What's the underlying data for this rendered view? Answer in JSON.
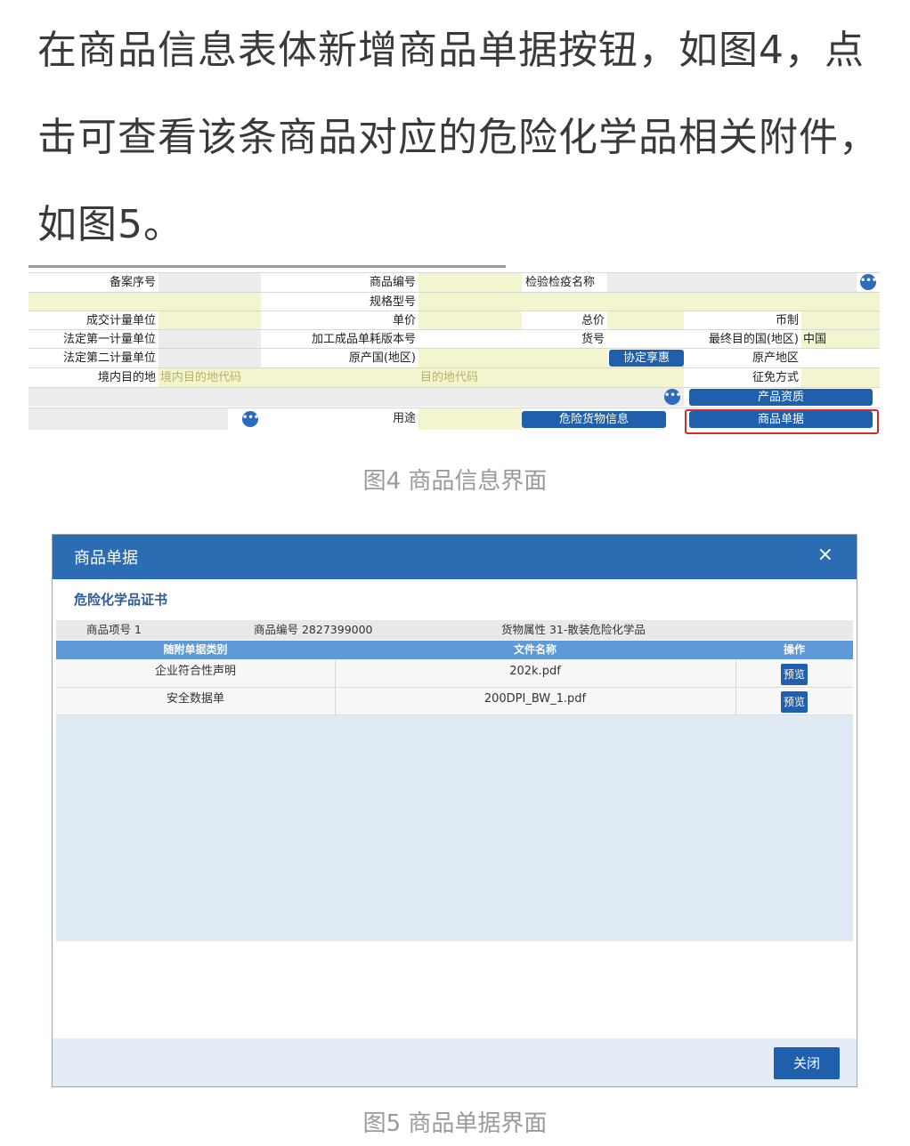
{
  "intro_text": "在商品信息表体新增商品单据按钮，如图4，点击可查看该条商品对应的危险化学品相关附件，如图5。",
  "fig4": {
    "caption": "图4 商品信息界面",
    "labels": {
      "record_no": "备案序号",
      "product_code": "商品编号",
      "ciq_name": "检验检疫名称",
      "spec_model": "规格型号",
      "deal_unit": "成交计量单位",
      "unit_price": "单价",
      "total_price": "总价",
      "currency": "币制",
      "legal_unit_1": "法定第一计量单位",
      "consumption_version": "加工成品单耗版本号",
      "goods_no": "货号",
      "dest_country": "最终目的国(地区)",
      "legal_unit_2": "法定第二计量单位",
      "origin_country": "原产国(地区)",
      "origin_region": "原产地区",
      "domestic_dest": "境内目的地",
      "exemption": "征免方式",
      "usage": "用途"
    },
    "placeholders": {
      "domestic_dest_code": "境内目的地代码",
      "dest_code": "目的地代码"
    },
    "values": {
      "dest_country": "中国"
    },
    "buttons": {
      "agreement": "协定享惠",
      "product_qualification": "产品资质",
      "dangerous_goods_info": "危险货物信息",
      "product_documents": "商品单据"
    },
    "dots_icon": "•••"
  },
  "fig5": {
    "caption": "图5 商品单据界面",
    "dialog_title": "商品单据",
    "close_icon": "×",
    "section_title": "危险化学品证书",
    "info": {
      "item_no": "商品项号 1",
      "product_code": "商品编号 2827399000",
      "goods_attr": "货物属性 31-散装危险化学品"
    },
    "columns": [
      "随附单据类别",
      "文件名称",
      "操作"
    ],
    "rows": [
      {
        "category": "企业符合性声明",
        "file": "202k.pdf",
        "action": "预览"
      },
      {
        "category": "安全数据单",
        "file": "200DPI_BW_1.pdf",
        "action": "预览"
      }
    ],
    "close_button": "关闭"
  }
}
